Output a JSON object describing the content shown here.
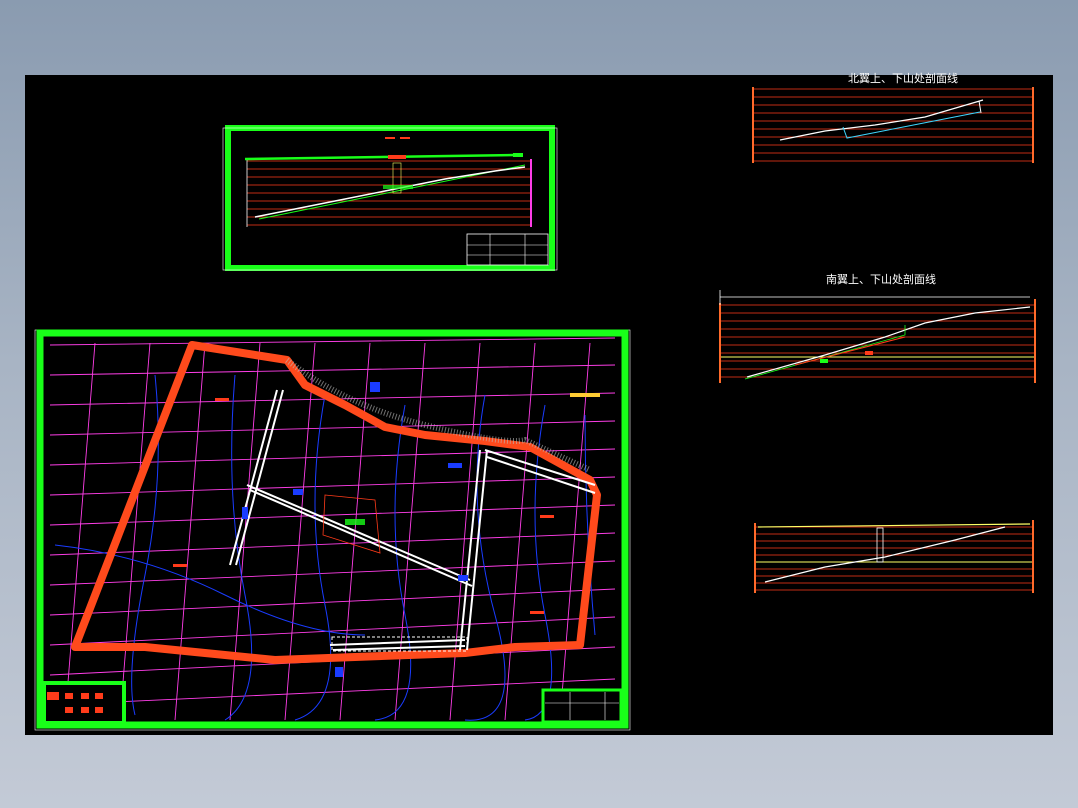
{
  "section_titles": {
    "north": "北翼上、下山处剖面线",
    "south": "南翼上、下山处剖面线"
  },
  "colors": {
    "frame": "#19ff19",
    "boundary": "#ff4a1c",
    "grid": "#ff3ee8",
    "contour": "#1a3cff",
    "profile_grid": "#ff3b1a",
    "canvas": "#000000",
    "outer": "#98a6b8"
  }
}
